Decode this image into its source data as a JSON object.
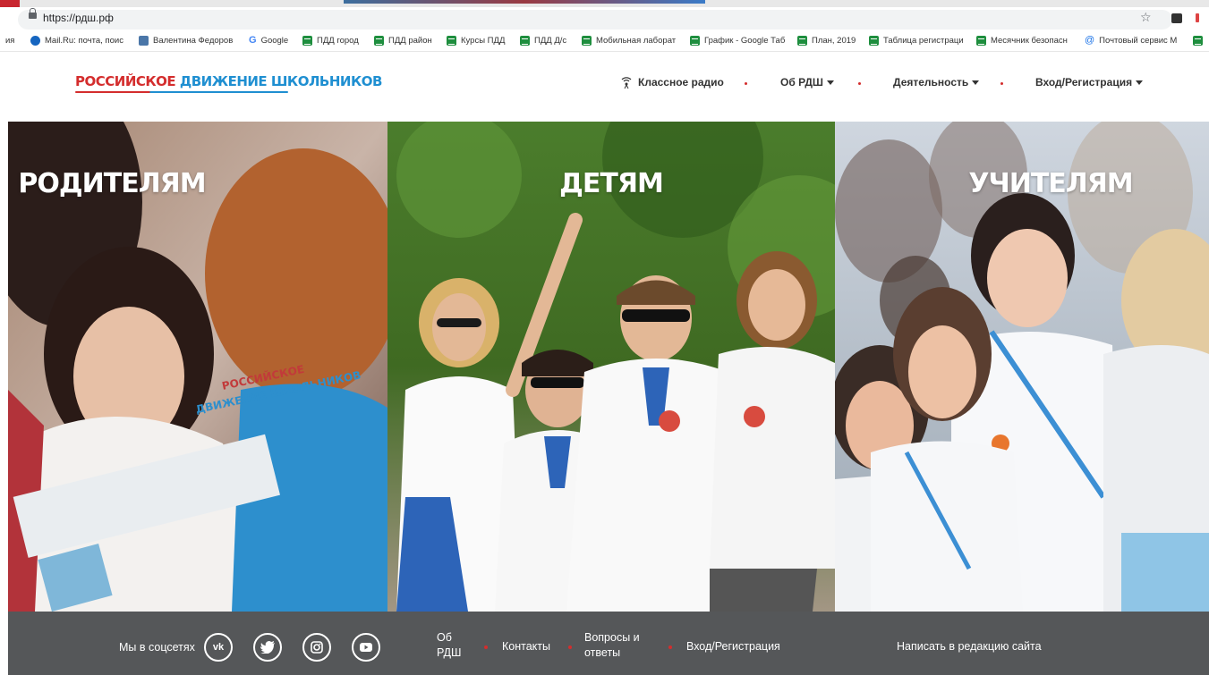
{
  "browser": {
    "url": "https://рдш.рф",
    "bookmarks": [
      {
        "label": "ия",
        "icon": "none"
      },
      {
        "label": "Mail.Ru: почта, поис",
        "icon": "mail-icon"
      },
      {
        "label": "Валентина Федоров",
        "icon": "vk-icon"
      },
      {
        "label": "Google",
        "icon": "google-icon"
      },
      {
        "label": "ПДД город",
        "icon": "sheet-icon"
      },
      {
        "label": "ПДД район",
        "icon": "sheet-icon"
      },
      {
        "label": "Курсы ПДД",
        "icon": "sheet-icon"
      },
      {
        "label": "ПДД Д/с",
        "icon": "sheet-icon"
      },
      {
        "label": "Мобильная лаборат",
        "icon": "sheet-icon"
      },
      {
        "label": "График - Google Таб",
        "icon": "sheet-icon"
      },
      {
        "label": "План, 2019",
        "icon": "sheet-icon"
      },
      {
        "label": "Таблица регистраци",
        "icon": "sheet-icon"
      },
      {
        "label": "Месячник безопасн",
        "icon": "sheet-icon"
      },
      {
        "label": "Почтовый сервис М",
        "icon": "at-icon"
      }
    ]
  },
  "site": {
    "logo": {
      "part1": "РОССИЙСКОЕ",
      "part2": "ДВИЖЕНИЕ ШКОЛЬНИКОВ"
    },
    "nav": {
      "radio": "Классное радио",
      "about": "Об РДШ",
      "activity": "Деятельность",
      "login": "Вход/Регистрация"
    }
  },
  "hero": {
    "panels": [
      {
        "title": "РОДИТЕЛЯМ"
      },
      {
        "title": "ДЕТЯМ"
      },
      {
        "title": "УЧИТЕЛЯМ"
      }
    ]
  },
  "footer": {
    "social_label": "Мы в соцсетях",
    "social": [
      {
        "label": "vk",
        "icon": "vk-icon"
      },
      {
        "label": "",
        "icon": "twitter-icon"
      },
      {
        "label": "",
        "icon": "instagram-icon"
      },
      {
        "label": "",
        "icon": "youtube-icon"
      }
    ],
    "links": {
      "about_line1": "Об",
      "about_line2": "РДШ",
      "contacts": "Контакты",
      "faq_line1": "Вопросы и",
      "faq_line2": "ответы",
      "login": "Вход/Регистрация",
      "write": "Написать в редакцию сайта"
    }
  },
  "colors": {
    "brand_red": "#d42d2d",
    "brand_blue": "#1f8fd1",
    "footer_bg": "#555759"
  }
}
